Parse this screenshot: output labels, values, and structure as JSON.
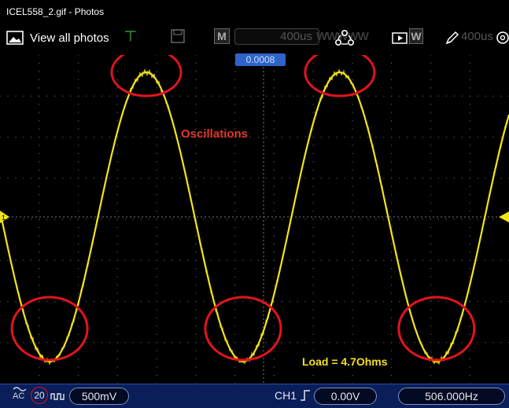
{
  "window": {
    "title": "ICEL558_2.gif - Photos"
  },
  "photos_toolbar": {
    "view_all_label": "View all photos"
  },
  "scope_toolbar": {
    "mode_letter": "M",
    "timebase": "400us",
    "wave_label": "WWWWW",
    "w_letter": "W",
    "timebase_right": "400us"
  },
  "trigger_marker": {
    "time_offset": "0.0008"
  },
  "annotations": {
    "oscillations": "Oscillations",
    "load": "Load = 4.7Ohms"
  },
  "status_bar": {
    "coupling": "AC",
    "bw_limit": "20",
    "ch1_scale": "500mV",
    "channel": "CH1",
    "trigger_level": "0.00V",
    "frequency": "506.000Hz"
  },
  "waveform": {
    "color": "#f2e21a",
    "frequency_hz": 506.0,
    "timebase_s_per_div": 0.0004
  },
  "highlight_color": "#e3141c"
}
